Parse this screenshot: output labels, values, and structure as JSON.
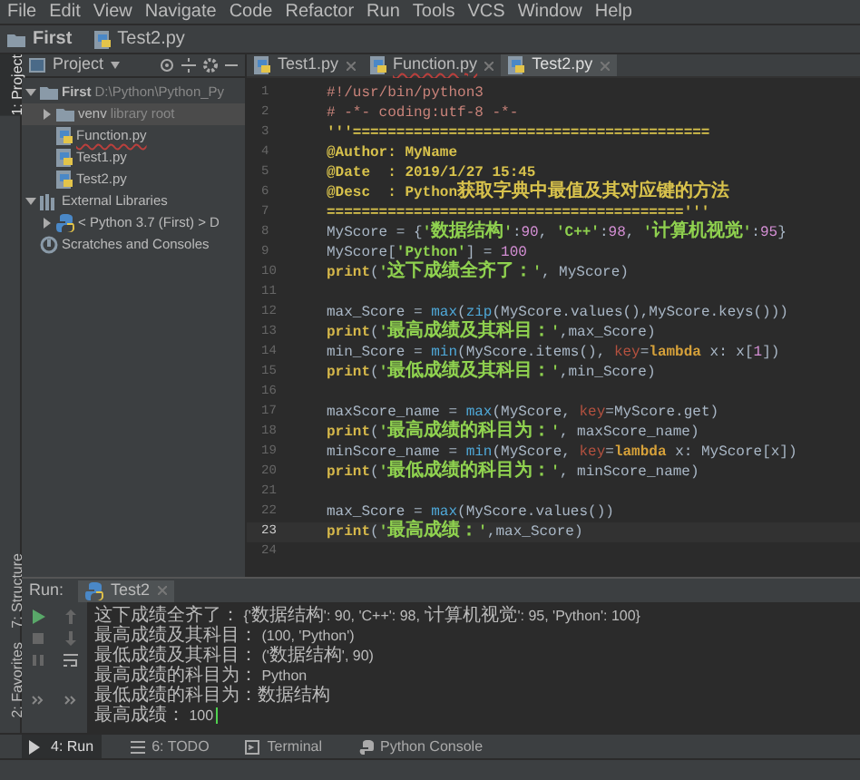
{
  "menu": [
    "File",
    "Edit",
    "View",
    "Navigate",
    "Code",
    "Refactor",
    "Run",
    "Tools",
    "VCS",
    "Window",
    "Help"
  ],
  "breadcrumb": [
    "First",
    "Test2.py"
  ],
  "side_tabs": [
    {
      "label": "1: Project",
      "selected": true
    },
    {
      "label": "7: Structure",
      "selected": false
    },
    {
      "label": "2: Favorites",
      "selected": false
    }
  ],
  "project_panel": {
    "title": "Project",
    "tree": [
      {
        "label": "First",
        "note": "D:\\Python\\Python_Py",
        "kind": "folder",
        "expanded": true,
        "children": [
          {
            "label": "venv",
            "note": "library root",
            "kind": "folder",
            "expanded": false,
            "selected": true
          },
          {
            "label": "Function.py",
            "kind": "python",
            "error": true
          },
          {
            "label": "Test1.py",
            "kind": "python",
            "error": false
          },
          {
            "label": "Test2.py",
            "kind": "python",
            "error": false
          }
        ]
      },
      {
        "label": "External Libraries",
        "kind": "library",
        "expanded": true,
        "children": [
          {
            "label": "< Python 3.7 (First) >  D",
            "kind": "sdk",
            "expanded": false
          }
        ]
      },
      {
        "label": "Scratches and Consoles",
        "kind": "scratch"
      }
    ]
  },
  "editor": {
    "tabs": [
      {
        "label": "Test1.py",
        "selected": false,
        "error": false
      },
      {
        "label": "Function.py",
        "selected": false,
        "error": true
      },
      {
        "label": "Test2.py",
        "selected": true,
        "error": false
      }
    ],
    "lines": [
      {
        "number": "1",
        "current": false,
        "tokens": [
          {
            "kind": "comment",
            "text": "#!/usr/bin/python3"
          }
        ]
      },
      {
        "number": "2",
        "current": false,
        "tokens": [
          {
            "kind": "comment",
            "text": "# -*- coding:utf-8 -*-"
          }
        ]
      },
      {
        "number": "3",
        "current": false,
        "tokens": [
          {
            "kind": "doc",
            "text": "'''========================================="
          }
        ]
      },
      {
        "number": "4",
        "current": false,
        "tokens": [
          {
            "kind": "doc",
            "text": "@Author: MyName"
          }
        ]
      },
      {
        "number": "5",
        "current": false,
        "tokens": [
          {
            "kind": "doc",
            "text": "@Date  : 2019/1/27 15:45"
          }
        ]
      },
      {
        "number": "6",
        "current": false,
        "tokens": [
          {
            "kind": "doc",
            "text": "@Desc  : Python获取字典中最值及其对应键的方法"
          }
        ]
      },
      {
        "number": "7",
        "current": false,
        "tokens": [
          {
            "kind": "doc",
            "text": "========================================='''"
          }
        ]
      },
      {
        "number": "8",
        "current": false,
        "tokens": [
          {
            "kind": "name",
            "text": "MyScore = {"
          },
          {
            "kind": "string",
            "text": "'数据结构'"
          },
          {
            "kind": "name",
            "text": ":"
          },
          {
            "kind": "number",
            "text": "90"
          },
          {
            "kind": "name",
            "text": ", "
          },
          {
            "kind": "string",
            "text": "'C++'"
          },
          {
            "kind": "name",
            "text": ":"
          },
          {
            "kind": "number",
            "text": "98"
          },
          {
            "kind": "name",
            "text": ", "
          },
          {
            "kind": "string",
            "text": "'计算机视觉'"
          },
          {
            "kind": "name",
            "text": ":"
          },
          {
            "kind": "number",
            "text": "95"
          },
          {
            "kind": "name",
            "text": "}"
          }
        ]
      },
      {
        "number": "9",
        "current": false,
        "tokens": [
          {
            "kind": "name",
            "text": "MyScore["
          },
          {
            "kind": "string",
            "text": "'Python'"
          },
          {
            "kind": "name",
            "text": "] = "
          },
          {
            "kind": "number",
            "text": "100"
          }
        ]
      },
      {
        "number": "10",
        "current": false,
        "tokens": [
          {
            "kind": "print",
            "text": "print"
          },
          {
            "kind": "name",
            "text": "("
          },
          {
            "kind": "string",
            "text": "'这下成绩全齐了：'"
          },
          {
            "kind": "name",
            "text": ", MyScore)"
          }
        ]
      },
      {
        "number": "11",
        "current": false
      },
      {
        "number": "12",
        "current": false,
        "tokens": [
          {
            "kind": "name",
            "text": "max_Score = "
          },
          {
            "kind": "builtin",
            "text": "max"
          },
          {
            "kind": "name",
            "text": "("
          },
          {
            "kind": "builtin",
            "text": "zip"
          },
          {
            "kind": "name",
            "text": "(MyScore.values(),MyScore.keys()))"
          }
        ]
      },
      {
        "number": "13",
        "current": false,
        "tokens": [
          {
            "kind": "print",
            "text": "print"
          },
          {
            "kind": "name",
            "text": "("
          },
          {
            "kind": "string",
            "text": "'最高成绩及其科目：'"
          },
          {
            "kind": "name",
            "text": ",max_Score)"
          }
        ]
      },
      {
        "number": "14",
        "current": false,
        "tokens": [
          {
            "kind": "name",
            "text": "min_Score = "
          },
          {
            "kind": "builtin",
            "text": "min"
          },
          {
            "kind": "name",
            "text": "(MyScore.items(), "
          },
          {
            "kind": "kwarg",
            "text": "key"
          },
          {
            "kind": "name",
            "text": "="
          },
          {
            "kind": "keyword",
            "text": "lambda"
          },
          {
            "kind": "name",
            "text": " x: x["
          },
          {
            "kind": "number",
            "text": "1"
          },
          {
            "kind": "name",
            "text": "])"
          }
        ]
      },
      {
        "number": "15",
        "current": false,
        "tokens": [
          {
            "kind": "print",
            "text": "print"
          },
          {
            "kind": "name",
            "text": "("
          },
          {
            "kind": "string",
            "text": "'最低成绩及其科目：'"
          },
          {
            "kind": "name",
            "text": ",min_Score)"
          }
        ]
      },
      {
        "number": "16",
        "current": false
      },
      {
        "number": "17",
        "current": false,
        "tokens": [
          {
            "kind": "name",
            "text": "maxScore_name = "
          },
          {
            "kind": "builtin",
            "text": "max"
          },
          {
            "kind": "name",
            "text": "(MyScore, "
          },
          {
            "kind": "kwarg",
            "text": "key"
          },
          {
            "kind": "name",
            "text": "=MyScore.get)"
          }
        ]
      },
      {
        "number": "18",
        "current": false,
        "tokens": [
          {
            "kind": "print",
            "text": "print"
          },
          {
            "kind": "name",
            "text": "("
          },
          {
            "kind": "string",
            "text": "'最高成绩的科目为：'"
          },
          {
            "kind": "name",
            "text": ", maxScore_name)"
          }
        ]
      },
      {
        "number": "19",
        "current": false,
        "tokens": [
          {
            "kind": "name",
            "text": "minScore_name = "
          },
          {
            "kind": "builtin",
            "text": "min"
          },
          {
            "kind": "name",
            "text": "(MyScore, "
          },
          {
            "kind": "kwarg",
            "text": "key"
          },
          {
            "kind": "name",
            "text": "="
          },
          {
            "kind": "keyword",
            "text": "lambda"
          },
          {
            "kind": "name",
            "text": " x: MyScore[x])"
          }
        ]
      },
      {
        "number": "20",
        "current": false,
        "tokens": [
          {
            "kind": "print",
            "text": "print"
          },
          {
            "kind": "name",
            "text": "("
          },
          {
            "kind": "string",
            "text": "'最低成绩的科目为：'"
          },
          {
            "kind": "name",
            "text": ", minScore_name)"
          }
        ]
      },
      {
        "number": "21",
        "current": false
      },
      {
        "number": "22",
        "current": false,
        "tokens": [
          {
            "kind": "name",
            "text": "max_Score = "
          },
          {
            "kind": "builtin",
            "text": "max"
          },
          {
            "kind": "name",
            "text": "(MyScore.values())"
          }
        ]
      },
      {
        "number": "23",
        "current": true,
        "tokens": [
          {
            "kind": "print",
            "text": "print"
          },
          {
            "kind": "name",
            "text": "("
          },
          {
            "kind": "string",
            "text": "'最高成绩：'"
          },
          {
            "kind": "name",
            "text": ",max_Score)"
          }
        ]
      },
      {
        "number": "24",
        "current": false
      }
    ]
  },
  "run_panel": {
    "label": "Run:",
    "tab": "Test2",
    "output": [
      "这下成绩全齐了： {'数据结构': 90, 'C++': 98, '计算机视觉': 95, 'Python': 100}",
      "最高成绩及其科目： (100, 'Python')",
      "最低成绩及其科目： ('数据结构', 90)",
      "最高成绩的科目为： Python",
      "最低成绩的科目为： 数据结构",
      "最高成绩： 100"
    ]
  },
  "bottom_tabs": [
    {
      "label": "4: Run",
      "kind": "run",
      "selected": true
    },
    {
      "label": "6: TODO",
      "kind": "todo",
      "selected": false
    },
    {
      "label": "Terminal",
      "kind": "terminal",
      "selected": false
    },
    {
      "label": "Python Console",
      "kind": "console",
      "selected": false
    }
  ]
}
